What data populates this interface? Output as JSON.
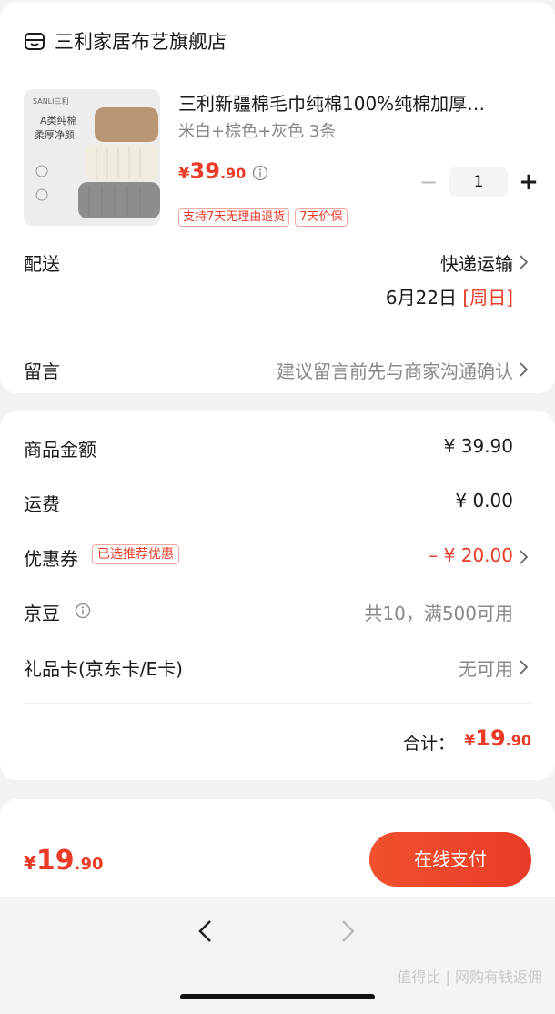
{
  "store": {
    "name": "三利家居布艺旗舰店",
    "icon": "store-icon"
  },
  "product": {
    "image_brand": "SANLI三利",
    "image_line1": "A类纯棉",
    "image_line2": "柔厚净颜",
    "title": "三利新疆棉毛巾纯棉100%纯棉加厚…",
    "spec": "米白+棕色+灰色 3条",
    "price_currency": "¥",
    "price_int": "39",
    "price_dec": ".90",
    "tags": [
      "支持7天无理由退货",
      "7天价保"
    ],
    "quantity": "1",
    "minus": "−",
    "plus": "+"
  },
  "delivery": {
    "label": "配送",
    "method": "快递运输",
    "date": "6月22日",
    "weekday": "[周日]"
  },
  "message": {
    "label": "留言",
    "placeholder": "建议留言前先与商家沟通确认"
  },
  "summary": {
    "goods_label": "商品金额",
    "goods_value": "¥ 39.90",
    "shipping_label": "运费",
    "shipping_value": "¥ 0.00",
    "coupon_label": "优惠券",
    "coupon_badge": "已选推荐优惠",
    "coupon_value": "– ¥ 20.00",
    "jingdou_label": "京豆",
    "jingdou_value": "共10，满500可用",
    "giftcard_label": "礼品卡(京东卡/E卡)",
    "giftcard_value": "无可用",
    "total_label": "合计：",
    "total_currency": "¥",
    "total_int": "19",
    "total_dec": ".90"
  },
  "bottom": {
    "currency": "¥",
    "price_int": "19",
    "price_dec": ".90",
    "pay_label": "在线支付"
  },
  "watermark": "值得比 | 网购有钱返佣"
}
